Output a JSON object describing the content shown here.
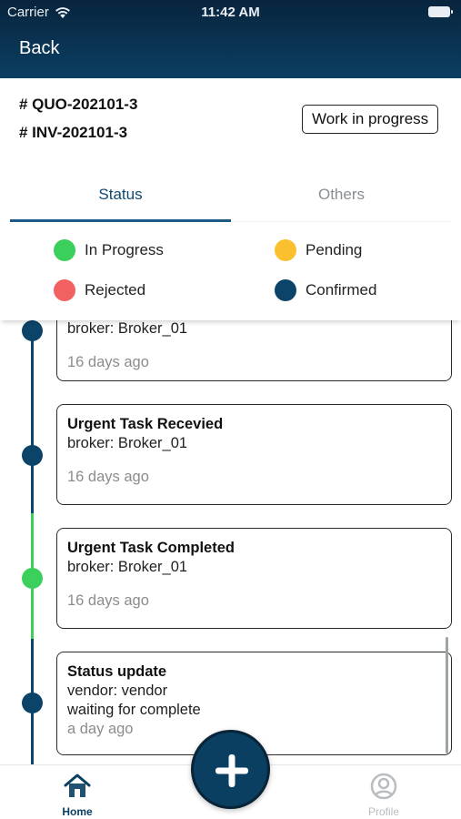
{
  "status_bar": {
    "carrier": "Carrier",
    "time": "11:42 AM"
  },
  "nav": {
    "back_label": "Back"
  },
  "refs": {
    "quote": "# QUO-202101-3",
    "invoice": "# INV-202101-3"
  },
  "status_pill": "Work in progress",
  "tabs": [
    {
      "label": "Status",
      "active": true
    },
    {
      "label": "Others",
      "active": false
    }
  ],
  "legend": [
    {
      "label": "In Progress",
      "color": "#3bcf5c"
    },
    {
      "label": "Pending",
      "color": "#fbc02d"
    },
    {
      "label": "Rejected",
      "color": "#f26161"
    },
    {
      "label": "Confirmed",
      "color": "#0b4468"
    }
  ],
  "timeline": [
    {
      "title": "",
      "lines": [
        "broker: Broker_01"
      ],
      "time": "16 days ago",
      "status": "Confirmed",
      "color": "#0b4468"
    },
    {
      "title": "Urgent Task Recevied",
      "lines": [
        "broker: Broker_01"
      ],
      "time": "16 days ago",
      "status": "Confirmed",
      "color": "#0b4468"
    },
    {
      "title": "Urgent Task Completed",
      "lines": [
        "broker: Broker_01"
      ],
      "time": "16 days ago",
      "status": "In Progress",
      "color": "#3bcf5c"
    },
    {
      "title": "Status update",
      "lines": [
        "vendor: vendor",
        "waiting for complete"
      ],
      "time": "a day ago",
      "status": "Confirmed",
      "color": "#0b4468"
    }
  ],
  "tabbar": {
    "home_label": "Home",
    "profile_label": "Profile",
    "home_icon": "home-icon",
    "profile_icon": "user-circle-icon"
  },
  "fab": {
    "icon": "plus-icon"
  }
}
